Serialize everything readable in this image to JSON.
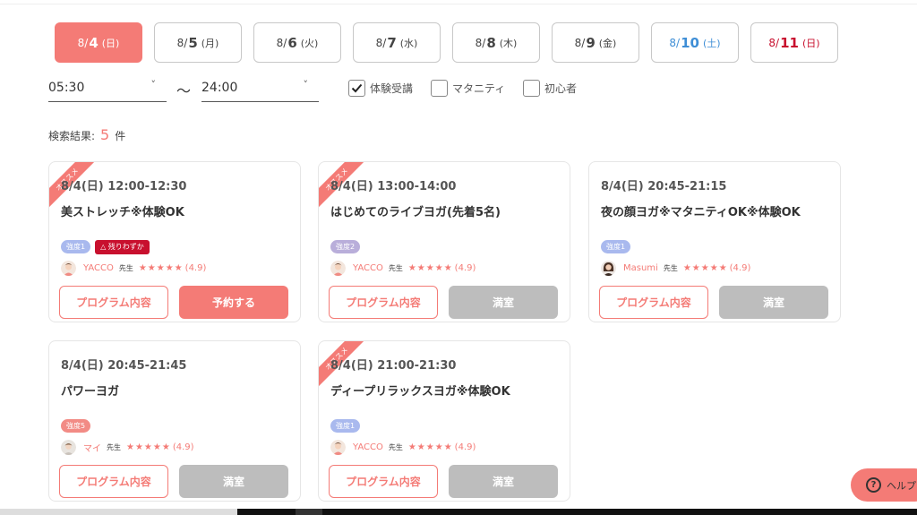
{
  "date_tabs": [
    {
      "md": "8/",
      "day": "4",
      "wd": "(日)",
      "state": "active"
    },
    {
      "md": "8/",
      "day": "5",
      "wd": "(月)",
      "state": ""
    },
    {
      "md": "8/",
      "day": "6",
      "wd": "(火)",
      "state": ""
    },
    {
      "md": "8/",
      "day": "7",
      "wd": "(水)",
      "state": ""
    },
    {
      "md": "8/",
      "day": "8",
      "wd": "(木)",
      "state": ""
    },
    {
      "md": "8/",
      "day": "9",
      "wd": "(金)",
      "state": ""
    },
    {
      "md": "8/",
      "day": "10",
      "wd": "(土)",
      "state": "sat"
    },
    {
      "md": "8/",
      "day": "11",
      "wd": "(日)",
      "state": "sun"
    }
  ],
  "filters": {
    "start_time": "05:30",
    "tilde": "〜",
    "end_time": "24:00",
    "chevron": "˅",
    "trial": {
      "label": "体験受講",
      "checked": true
    },
    "maternity": {
      "label": "マタニティ",
      "checked": false
    },
    "beginner": {
      "label": "初心者",
      "checked": false
    }
  },
  "result": {
    "label": "検索結果:",
    "count": "5",
    "unit": "件"
  },
  "ribbon_text": "オススメ",
  "detail_label": "プログラム内容",
  "sensei_label": "先生",
  "stars": "★★★★★",
  "classes": [
    {
      "time": "8/4(日) 12:00-12:30",
      "title": "美ストレッチ※体験OK",
      "level": "強度1",
      "level_class": "lv1",
      "warning": "△ 残りわずか",
      "instructor": "YACCO",
      "rating": "(4.9)",
      "action": "予約する",
      "action_type": "reserve",
      "recommended": true,
      "avatar": "a1"
    },
    {
      "time": "8/4(日) 13:00-14:00",
      "title": "はじめてのライブヨガ(先着5名)",
      "level": "強度2",
      "level_class": "lv2",
      "warning": "",
      "instructor": "YACCO",
      "rating": "(4.9)",
      "action": "満室",
      "action_type": "full",
      "recommended": true,
      "avatar": "a1"
    },
    {
      "time": "8/4(日) 20:45-21:15",
      "title": "夜の顔ヨガ※マタニティOK※体験OK",
      "level": "強度1",
      "level_class": "lv1",
      "warning": "",
      "instructor": "Masumi",
      "rating": "(4.9)",
      "action": "満室",
      "action_type": "full",
      "recommended": false,
      "avatar": "a2"
    },
    {
      "time": "8/4(日) 20:45-21:45",
      "title": "パワーヨガ",
      "level": "強度5",
      "level_class": "lv5",
      "warning": "",
      "instructor": "マイ",
      "rating": "(4.9)",
      "action": "満室",
      "action_type": "full",
      "recommended": false,
      "avatar": "a3"
    },
    {
      "time": "8/4(日) 21:00-21:30",
      "title": "ディープリラックスヨガ※体験OK",
      "level": "強度1",
      "level_class": "lv1",
      "warning": "",
      "instructor": "YACCO",
      "rating": "(4.9)",
      "action": "満室",
      "action_type": "full",
      "recommended": true,
      "avatar": "a1"
    }
  ],
  "help": {
    "label": "ヘルプ",
    "icon": "?"
  }
}
